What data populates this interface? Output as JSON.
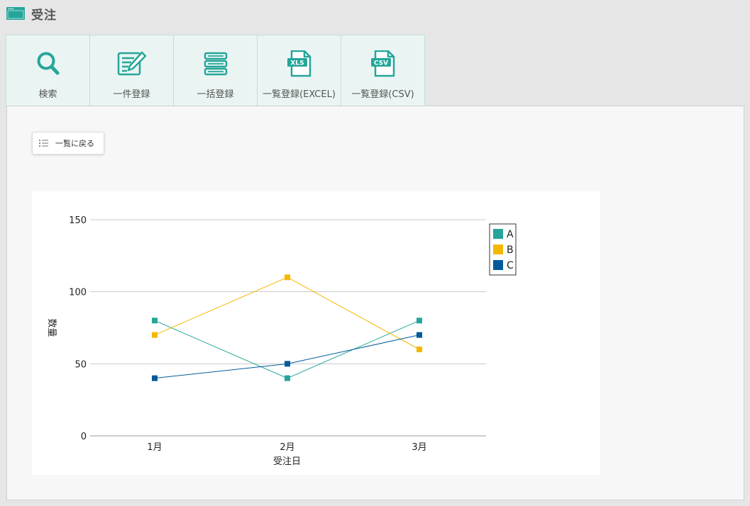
{
  "header": {
    "title": "受注",
    "icon": "window-icon"
  },
  "toolbar": {
    "items": [
      {
        "label": "検索",
        "icon": "search-icon"
      },
      {
        "label": "一件登録",
        "icon": "edit-icon"
      },
      {
        "label": "一括登録",
        "icon": "stack-icon"
      },
      {
        "label": "一覧登録(EXCEL)",
        "icon": "xls-file-icon",
        "badge": "XLS"
      },
      {
        "label": "一覧登録(CSV)",
        "icon": "csv-file-icon",
        "badge": "CSV"
      }
    ]
  },
  "back_button": {
    "label": "一覧に戻る",
    "icon": "list-icon"
  },
  "colors": {
    "accent": "#26a69a",
    "A": "#26a69a",
    "B": "#f5b800",
    "C": "#005a9c"
  },
  "chart_data": {
    "type": "line",
    "categories": [
      "1月",
      "2月",
      "3月"
    ],
    "series": [
      {
        "name": "A",
        "values": [
          80,
          40,
          80
        ],
        "color": "#26a69a"
      },
      {
        "name": "B",
        "values": [
          70,
          110,
          60
        ],
        "color": "#f5b800"
      },
      {
        "name": "C",
        "values": [
          40,
          50,
          70
        ],
        "color": "#005a9c"
      }
    ],
    "xlabel": "受注日",
    "ylabel": "数量",
    "ylim": [
      0,
      150
    ],
    "yticks": [
      0,
      50,
      100,
      150
    ],
    "grid": true,
    "legend": "top-right"
  }
}
